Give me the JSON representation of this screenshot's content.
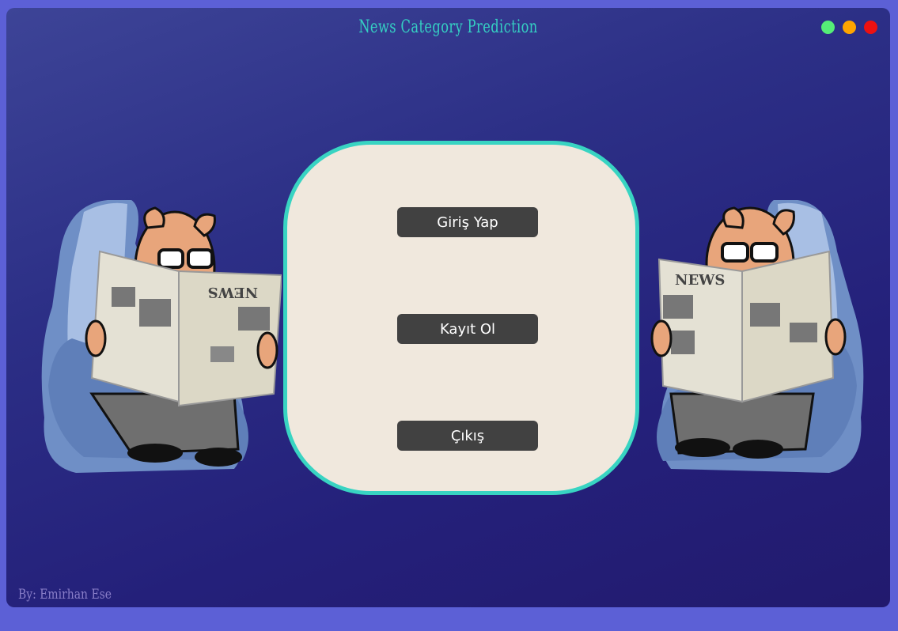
{
  "window": {
    "title": "News Category Prediction",
    "author": "By: Emirhan Ese",
    "controls": [
      "green",
      "orange",
      "red"
    ]
  },
  "menu": {
    "login_label": "Giriş Yap",
    "register_label": "Kayıt Ol",
    "exit_label": "Çıkış"
  },
  "illustrations": {
    "left_news": "NEWS",
    "right_news": "NEWS"
  },
  "colors": {
    "accent": "#35d0c3",
    "button_bg": "#414141",
    "card_bg": "#f0e8dd",
    "close": "#ee1111",
    "minimize": "#ffa500",
    "maximize": "#55ee77"
  }
}
